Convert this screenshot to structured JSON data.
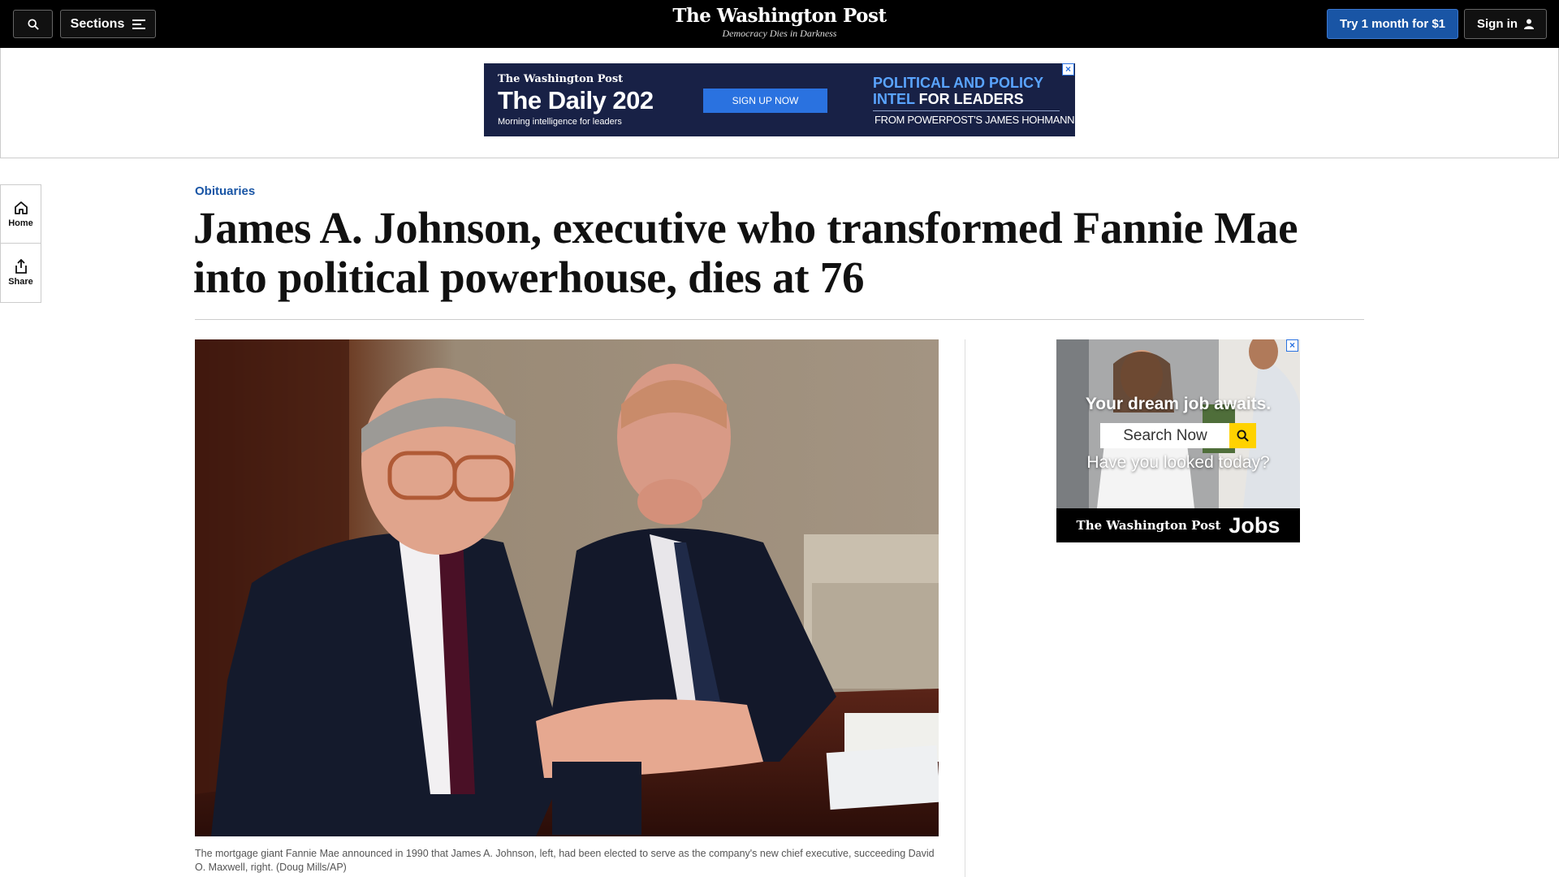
{
  "header": {
    "search_label": "",
    "sections_label": "Sections",
    "logo_name": "The Washington Post",
    "logo_tagline": "Democracy Dies in Darkness",
    "try_label": "Try 1 month for $1",
    "signin_label": "Sign in"
  },
  "leaderboard_ad": {
    "brand": "The Washington Post",
    "title": "The Daily 202",
    "subtitle": "Morning intelligence for leaders",
    "cta": "SIGN UP NOW",
    "tagline_line1": "POLITICAL AND POLICY",
    "tagline_line2_accent": "INTEL",
    "tagline_line2_rest": " FOR LEADERS",
    "byline": "FROM POWERPOST'S JAMES HOHMANN",
    "close_glyph": "×"
  },
  "left_rail": {
    "home_label": "Home",
    "share_label": "Share"
  },
  "article": {
    "kicker": "Obituaries",
    "headline": "James A. Johnson, executive who transformed Fannie Mae into political powerhouse, dies at 76",
    "caption": "The mortgage giant Fannie Mae announced in 1990 that James A. Johnson, left, had been elected to serve as the company's new chief executive, succeeding David O. Maxwell, right. (Doug Mills/AP)"
  },
  "side_ad": {
    "headline": "Your dream job awaits.",
    "search_placeholder": "Search Now",
    "question": "Have you looked today?",
    "brand": "The Washington Post",
    "product": "Jobs",
    "close_glyph": "×"
  },
  "colors": {
    "topbar": "#000000",
    "accent_blue": "#1955a5",
    "ad_navy": "#182146",
    "ad_button": "#2a72e0",
    "search_yellow": "#ffd200"
  }
}
